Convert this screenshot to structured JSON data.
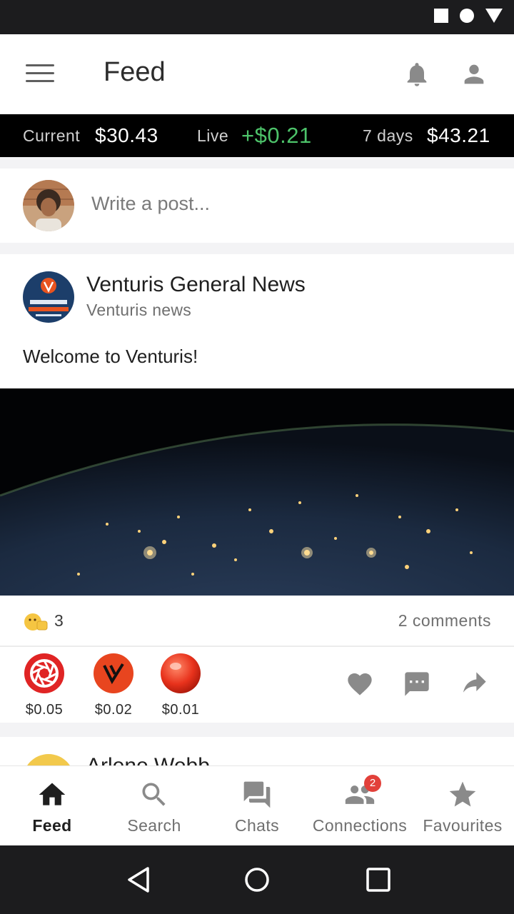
{
  "status_bar": {
    "icons": [
      "square-icon",
      "circle-icon",
      "triangle-icon"
    ]
  },
  "header": {
    "title": "Feed",
    "menu_icon": "hamburger-icon",
    "notifications_icon": "bell-icon",
    "profile_icon": "person-icon"
  },
  "ticker": {
    "current_label": "Current",
    "current_value": "$30.43",
    "live_label": "Live",
    "live_value": "+$0.21",
    "week_label": "7 days",
    "week_value": "$43.21",
    "live_color": "#4dc36a"
  },
  "composer": {
    "placeholder": "Write a post..."
  },
  "post": {
    "author": "Venturis General News",
    "subtitle": "Venturis news",
    "text": "Welcome to Venturis!",
    "reaction_count": "3",
    "comments": "2 comments",
    "tips": [
      {
        "icon": "shutter-coin-icon",
        "value": "$0.05"
      },
      {
        "icon": "venturis-coin-icon",
        "value": "$0.02"
      },
      {
        "icon": "red-orb-coin-icon",
        "value": "$0.01"
      }
    ]
  },
  "next_post": {
    "author": "Arlene Webb"
  },
  "bottom_nav": {
    "items": [
      {
        "label": "Feed",
        "icon": "home-icon"
      },
      {
        "label": "Search",
        "icon": "search-icon"
      },
      {
        "label": "Chats",
        "icon": "chat-icon"
      },
      {
        "label": "Connections",
        "icon": "people-icon",
        "badge": "2"
      },
      {
        "label": "Favourites",
        "icon": "star-icon"
      }
    ]
  },
  "colors": {
    "accent_dark": "#000000",
    "badge": "#e2403a",
    "icon_grey": "#8a8a8a"
  }
}
